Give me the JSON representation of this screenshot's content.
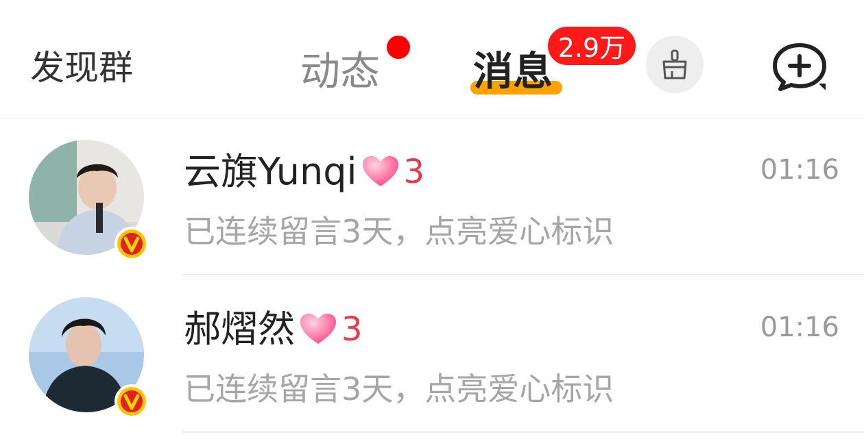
{
  "header": {
    "left_link": "发现群",
    "tabs": [
      {
        "label": "动态",
        "has_dot": true
      },
      {
        "label": "消息",
        "badge": "2.9万",
        "active": true
      }
    ],
    "accent_color": "#ffa200",
    "badge_color": "#ff1a1a"
  },
  "messages": [
    {
      "name": "云旗Yunqi",
      "heart_count": "3",
      "time": "01:16",
      "preview": "已连续留言3天，点亮爱心标识",
      "verified": true
    },
    {
      "name": "郝熠然",
      "heart_count": "3",
      "time": "01:16",
      "preview": "已连续留言3天，点亮爱心标识",
      "verified": true
    }
  ]
}
